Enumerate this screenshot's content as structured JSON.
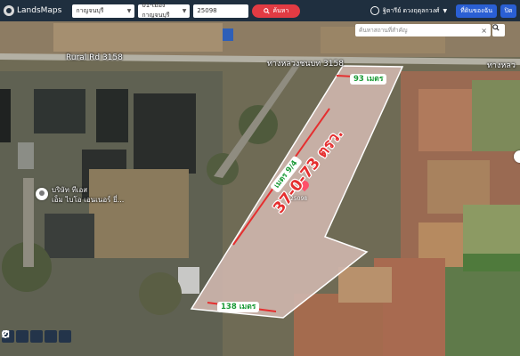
{
  "app": {
    "logo_text": "LandsMaps"
  },
  "toolbar": {
    "province": "กาญจนบุรี",
    "district": "01-เมืองกาญจนบุรี",
    "parcel_number": "25098",
    "search_label": "ค้นหา"
  },
  "user": {
    "name": "ฐิตารีย์ ดวงฤดุลกวงศ์"
  },
  "buttons": {
    "share_label": "ที่ดินของฉัน",
    "close_label": "ปิด"
  },
  "map": {
    "search_placeholder": "ค้นหาสถานที่สำคัญ",
    "roads": {
      "rural_rd": "Rural Rd 3158",
      "highway": "ทางหลวงชนบท 3158",
      "highway_cut": "ทางหลว"
    },
    "poi": {
      "line1": "บริษัท ทีเอส",
      "line2": "เอ็ม ไบโอ เอนเนอร์ ยี่..."
    },
    "measurements": {
      "top": "93 เมตร",
      "left": "เมตร 9/4",
      "bottom": "138 เมตร"
    },
    "area": "37-0-73 ตรว.",
    "parcel_id": "25098"
  },
  "colors": {
    "accent": "#e23b43",
    "measure": "#1a9a36",
    "parcel_fill": "#cdb5ad",
    "parcel_edge": "#e52f2f",
    "primary": "#2a5fd4"
  }
}
